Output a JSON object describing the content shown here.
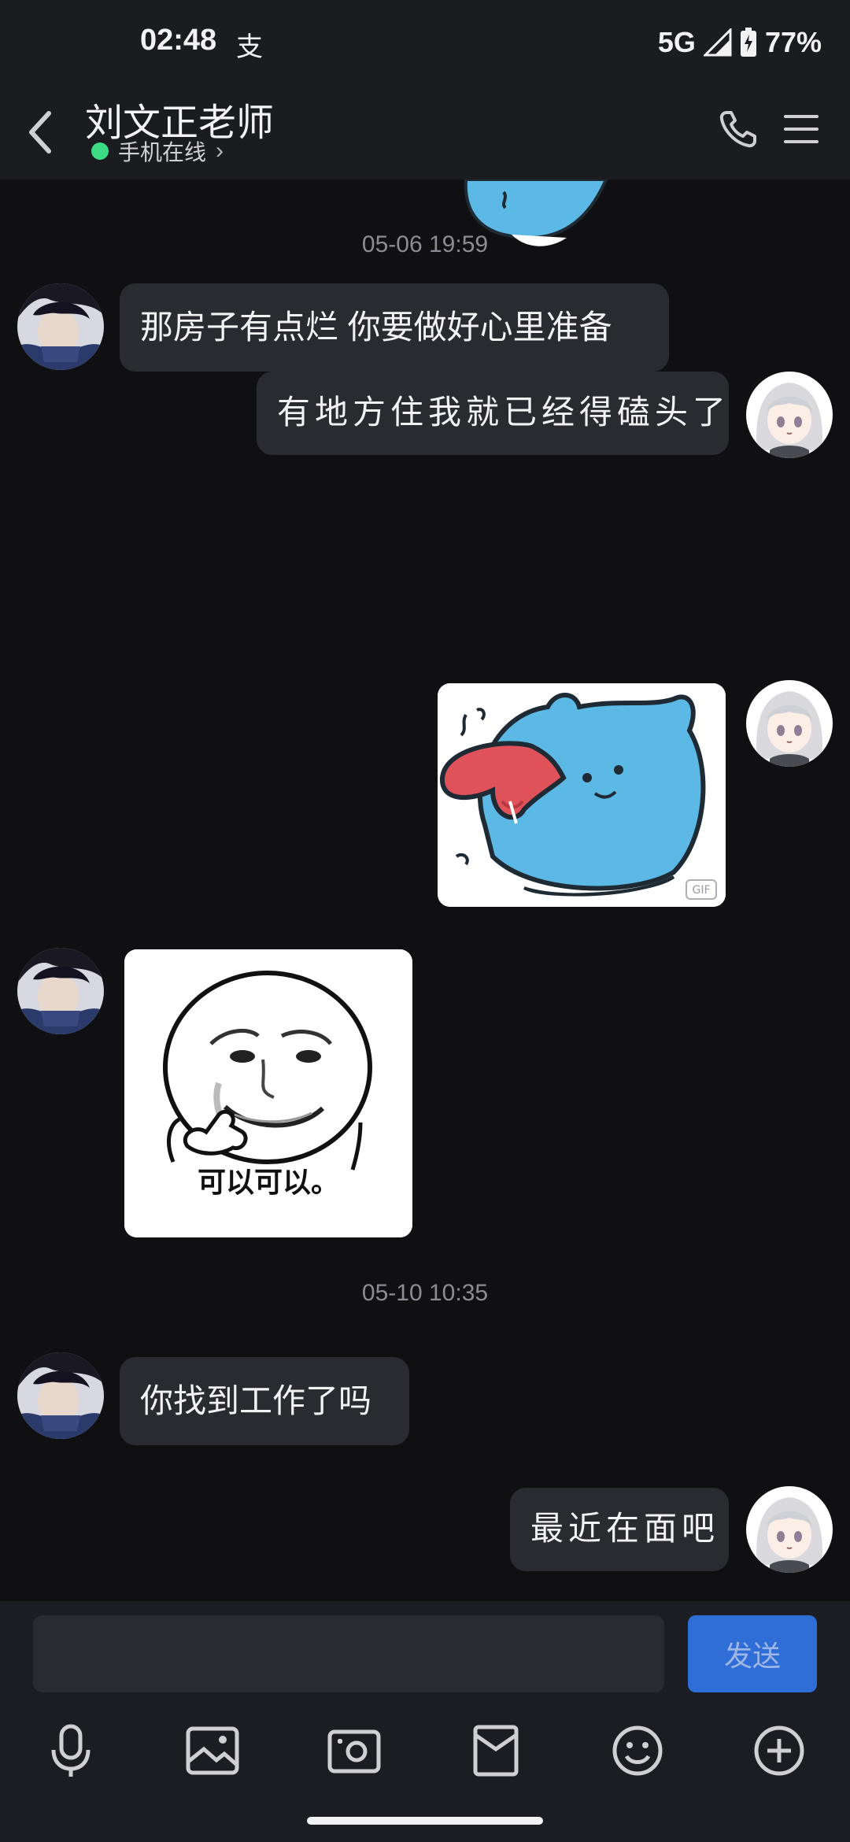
{
  "status_bar": {
    "time": "02:48",
    "app_indicator": "支",
    "network": "5G",
    "battery": "77%"
  },
  "header": {
    "title": "刘文正老师",
    "presence": "手机在线",
    "icons": {
      "back": "back-chevron-icon",
      "call": "phone-icon",
      "menu": "menu-icon"
    }
  },
  "chat": {
    "timestamps": [
      "05-06 19:59",
      "05-10 10:35"
    ],
    "messages": [
      {
        "sender": "contact",
        "type": "text",
        "text": "那房子有点烂 你要做好心里准备"
      },
      {
        "sender": "me",
        "type": "text",
        "text": "有地方住我就已经得磕头了"
      },
      {
        "sender": "me",
        "type": "sticker",
        "badge": "GIF"
      },
      {
        "sender": "contact",
        "type": "sticker",
        "caption": "可以可以。"
      },
      {
        "sender": "contact",
        "type": "text",
        "text": "你找到工作了吗"
      },
      {
        "sender": "me",
        "type": "text",
        "text": "最近在面吧"
      }
    ]
  },
  "composer": {
    "placeholder": "",
    "send_label": "发送",
    "tools": [
      "microphone-icon",
      "image-icon",
      "camera-icon",
      "red-envelope-icon",
      "emoji-icon",
      "plus-icon"
    ]
  },
  "colors": {
    "background": "#101012",
    "bar": "#1b1c20",
    "bubble": "#2a2b30",
    "online": "#3ddc84",
    "send_button": "#2f6ed6",
    "sticker_blue": "#5cb8e4",
    "tongue": "#e0525a"
  }
}
